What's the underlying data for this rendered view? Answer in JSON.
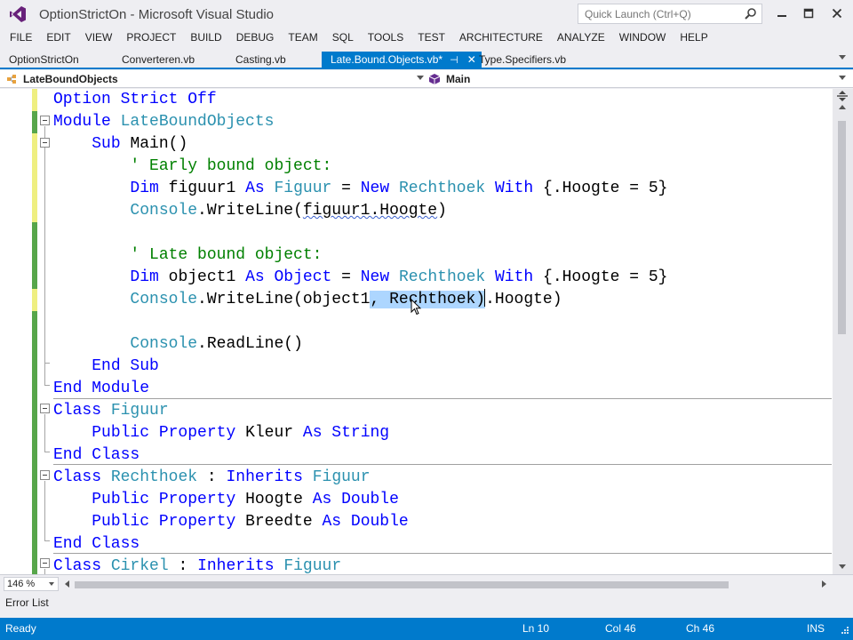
{
  "window": {
    "title": "OptionStrictOn - Microsoft Visual Studio",
    "quick_launch_placeholder": "Quick Launch (Ctrl+Q)"
  },
  "menu": [
    "FILE",
    "EDIT",
    "VIEW",
    "PROJECT",
    "BUILD",
    "DEBUG",
    "TEAM",
    "SQL",
    "TOOLS",
    "TEST",
    "ARCHITECTURE",
    "ANALYZE",
    "WINDOW",
    "HELP"
  ],
  "tabs": [
    {
      "label": "OptionStrictOn"
    },
    {
      "label": "Converteren.vb"
    },
    {
      "label": "Casting.vb"
    },
    {
      "label": "Late.Bound.Objects.vb*",
      "active": true
    },
    {
      "label": "Type.Specifiers.vb"
    }
  ],
  "navbar": {
    "left": "LateBoundObjects",
    "right": "Main"
  },
  "code": {
    "l1_kw": "Option Strict Off",
    "l2_kw": "Module",
    "l2_name": "LateBoundObjects",
    "l3_kw": "Sub",
    "l3_rest": "Main()",
    "l4_comment": "' Early bound object:",
    "l5_dim": "Dim",
    "l5_var": "figuur1",
    "l5_as": "As",
    "l5_type": "Figuur",
    "l5_eq": "=",
    "l5_new": "New",
    "l5_type2": "Rechthoek",
    "l5_with": "With",
    "l5_rest": "{.Hoogte = 5}",
    "l6_console": "Console",
    "l6_call": ".WriteLine(",
    "l6_arg": "figuur1.Hoogte",
    "l6_end": ")",
    "l8_comment": "' Late bound object:",
    "l9_dim": "Dim",
    "l9_var": "object1",
    "l9_as": "As",
    "l9_type": "Object",
    "l9_eq": "=",
    "l9_new": "New",
    "l9_type2": "Rechthoek",
    "l9_with": "With",
    "l9_rest": "{.Hoogte = 5}",
    "l10_console": "Console",
    "l10_call": ".WriteLine(object1",
    "l10_sel": ", Rechthoek)",
    "l10_rest": ".Hoogte)",
    "l12_console": "Console",
    "l12_call": ".ReadLine()",
    "l13_kw": "End Sub",
    "l14_kw": "End Module",
    "l15_kw": "Class",
    "l15_name": "Figuur",
    "l16_kw1": "Public Property",
    "l16_name": "Kleur",
    "l16_as": "As String",
    "l17_kw": "End Class",
    "l18_kw": "Class",
    "l18_name": "Rechthoek",
    "l18_colon": ":",
    "l18_inh": "Inherits",
    "l18_base": "Figuur",
    "l19_kw1": "Public Property",
    "l19_name": "Hoogte",
    "l19_as": "As Double",
    "l20_kw1": "Public Property",
    "l20_name": "Breedte",
    "l20_as": "As Double",
    "l21_kw": "End Class",
    "l22_kw": "Class",
    "l22_name": "Cirkel",
    "l22_colon": ":",
    "l22_inh": "Inherits",
    "l22_base": "Figuur"
  },
  "zoom": "146 %",
  "error_list": "Error List",
  "status": {
    "ready": "Ready",
    "ln": "Ln 10",
    "col": "Col 46",
    "ch": "Ch 46",
    "mode": "INS"
  },
  "colors": {
    "accent": "#007acc",
    "keyword": "#0000ff",
    "type": "#2b91af",
    "comment": "#008000",
    "selection": "#add6ff",
    "saved_change": "#57a64a",
    "unsaved_change": "#efef80"
  }
}
